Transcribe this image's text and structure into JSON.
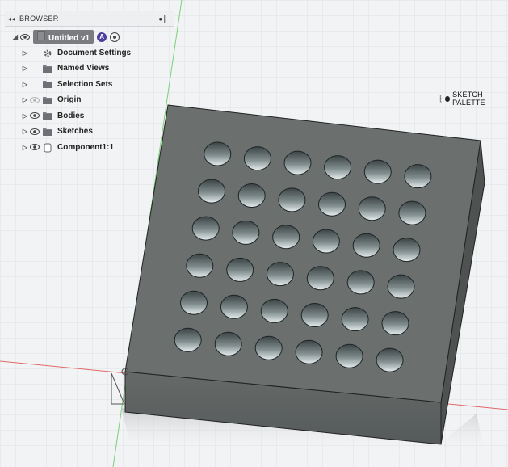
{
  "browser": {
    "header": {
      "collapse_icon": "◂◂",
      "title": "BROWSER",
      "pin_icon": "●"
    },
    "root": {
      "label": "Untitled v1"
    },
    "items": [
      {
        "label": "Document Settings",
        "icon": "gear-icon",
        "eye": false
      },
      {
        "label": "Named Views",
        "icon": "folder-icon",
        "eye": false
      },
      {
        "label": "Selection Sets",
        "icon": "folder-icon",
        "eye": false
      },
      {
        "label": "Origin",
        "icon": "folder-icon",
        "eye": true,
        "eye_faded": true
      },
      {
        "label": "Bodies",
        "icon": "folder-icon",
        "eye": true
      },
      {
        "label": "Sketches",
        "icon": "folder-icon",
        "eye": true
      },
      {
        "label": "Component1:1",
        "icon": "component-icon",
        "eye": true
      }
    ]
  },
  "sketch_palette": {
    "label": "SKETCH PALETTE"
  },
  "colors": {
    "block_top": "#6b706f",
    "block_front": "#5f6461",
    "block_side": "#4e5352",
    "x_axis": "#e06a6a",
    "y_axis": "#7ad07a",
    "grid": "#dde0e6",
    "hole_light": "#e3eced",
    "hole_dark": "#404849"
  }
}
